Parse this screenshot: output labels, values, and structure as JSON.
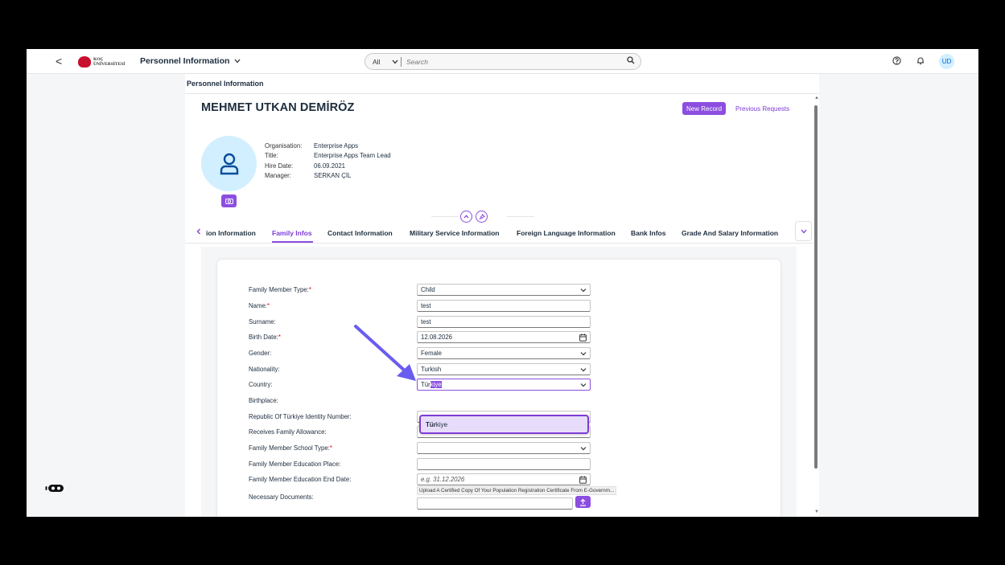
{
  "shellbar": {
    "back_label": "<",
    "logo_line1": "KOÇ",
    "logo_line2": "ÜNİVERSİTESİ",
    "app_title": "Personnel Information",
    "search_scope": "All",
    "search_placeholder": "Search",
    "user_initials": "UD"
  },
  "page": {
    "title": "Personnel Information",
    "person_name": "MEHMET UTKAN DEMİRÖZ",
    "new_record_label": "New Record",
    "previous_requests_label": "Previous Requests",
    "info": [
      {
        "label": "Organisation:",
        "value": "Enterprise Apps"
      },
      {
        "label": "Title:",
        "value": "Enterprise Apps Team Lead"
      },
      {
        "label": "Hire Date:",
        "value": "06.09.2021"
      },
      {
        "label": "Manager:",
        "value": "SERKAN ÇİL"
      }
    ]
  },
  "tabs": [
    {
      "label": "ion Information"
    },
    {
      "label": "Family Infos"
    },
    {
      "label": "Contact Information"
    },
    {
      "label": "Military Service Information"
    },
    {
      "label": "Foreign Language Information"
    },
    {
      "label": "Bank Infos"
    },
    {
      "label": "Grade And Salary Information"
    }
  ],
  "form": {
    "family_member_type": {
      "label": "Family Member Type:",
      "value": "Child"
    },
    "name": {
      "label": "Name:",
      "value": "test"
    },
    "surname": {
      "label": "Surname:",
      "value": "test"
    },
    "birth_date": {
      "label": "Birth Date:",
      "value": "12.08.2026"
    },
    "gender": {
      "label": "Gender:",
      "value": "Female"
    },
    "nationality": {
      "label": "Nationality:",
      "value": "Turkish"
    },
    "country": {
      "label": "Country:",
      "typed": "Tür",
      "autocomplete": "kiye"
    },
    "birthplace": {
      "label": "Birthplace:"
    },
    "identity_number": {
      "label": "Republic Of Türkiye Identity Number:"
    },
    "family_allowance": {
      "label": "Receives Family Allowance:"
    },
    "school_type": {
      "label": "Family Member School Type:"
    },
    "education_place": {
      "label": "Family Member Education Place:"
    },
    "education_end_date": {
      "label": "Family Member Education End Date:",
      "placeholder": "e.g. 31.12.2026"
    },
    "documents": {
      "label": "Necessary Documents:",
      "note": "Upload A Certified Copy Of Your Population Registration Certificate From E-Governm..."
    }
  },
  "suggestion": {
    "match": "Tür",
    "rest": "kiye"
  },
  "required_mark": "*",
  "colors": {
    "accent": "#8c4ee0",
    "avatar_bg": "#d1efff",
    "annotation_arrow": "#6a5cf0"
  }
}
